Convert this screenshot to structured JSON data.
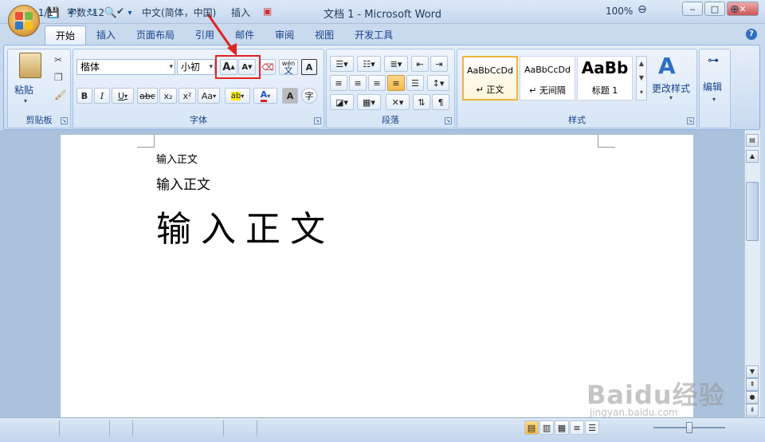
{
  "window": {
    "title": "文档 1 - Microsoft Word",
    "minimize": "‒",
    "maximize": "□",
    "close": "✕"
  },
  "qat": {
    "save": "💾",
    "undo": "↶",
    "redo": "↻",
    "print_preview": "🔍",
    "customize": "▾"
  },
  "tabs": [
    "开始",
    "插入",
    "页面布局",
    "引用",
    "邮件",
    "审阅",
    "视图",
    "开发工具"
  ],
  "help": "?",
  "clipboard": {
    "paste_label": "粘贴",
    "group_label": "剪贴板"
  },
  "font": {
    "name": "楷体",
    "size": "小初",
    "group_label": "字体",
    "grow": "A",
    "shrink": "A",
    "bold": "B",
    "italic": "I",
    "underline": "U",
    "strike": "abc",
    "subscript": "x₂",
    "superscript": "x²",
    "change_case": "Aa",
    "highlight": "ab",
    "font_color": "A",
    "char_shading": "A",
    "enclose": "字",
    "phonetic": "wén",
    "phonetic_char": "文",
    "border_char": "A"
  },
  "paragraph": {
    "group_label": "段落"
  },
  "styles": {
    "group_label": "样式",
    "items": [
      {
        "preview": "AaBbCcDd",
        "name": "↵ 正文"
      },
      {
        "preview": "AaBbCcDd",
        "name": "↵ 无间隔"
      },
      {
        "preview": "AaBb",
        "name": "标题 1"
      }
    ],
    "change_label": "更改样式"
  },
  "editing": {
    "label": "编辑"
  },
  "document": {
    "lines": [
      "输入正文",
      "输入正文",
      "输入正文"
    ]
  },
  "statusbar": {
    "page": "页面: 1/1",
    "words": "字数: 12",
    "language": "中文(简体，中国)",
    "insert": "插入",
    "zoom": "100%",
    "zoom_out": "⊖",
    "zoom_in": "⊕",
    "zoom_level": 0.5
  },
  "colors": {
    "accent": "#15428b",
    "annotation": "#e02424"
  },
  "watermark": {
    "brand": "Baidu经验",
    "url": "jingyan.baidu.com"
  }
}
